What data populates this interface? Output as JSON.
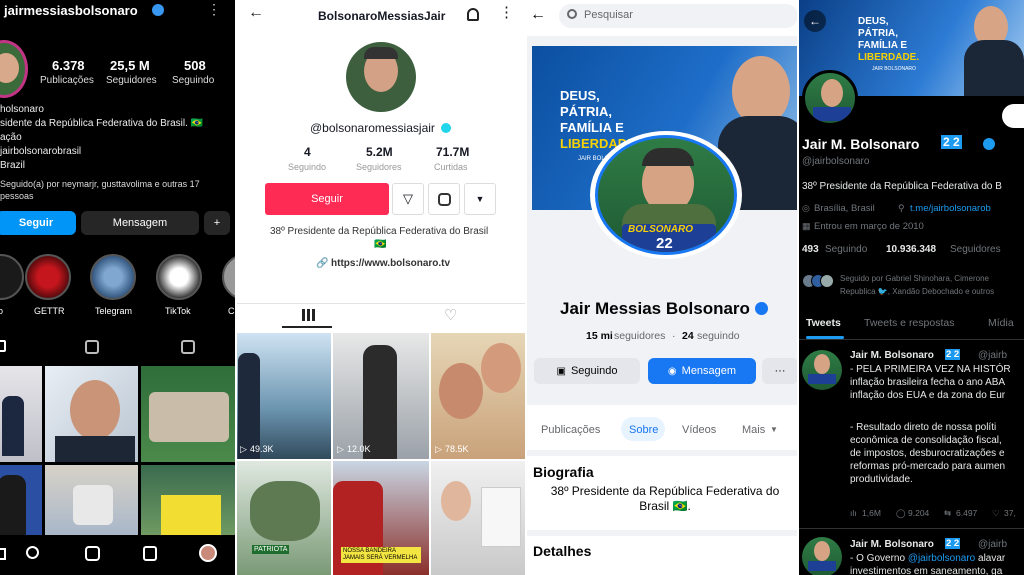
{
  "instagram": {
    "username": "jairmessiasbolsonaro",
    "stats": [
      {
        "value": "6.378",
        "label": "Publicações"
      },
      {
        "value": "25,5 M",
        "label": "Seguidores"
      },
      {
        "value": "508",
        "label": "Seguindo"
      }
    ],
    "bio": [
      "holsonaro",
      "sidente da República Federativa do Brasil. 🇧🇷",
      "ação",
      "jairbolsonarobrasil",
      "Brazil"
    ],
    "followed_by": "Seguido(a) por neymarjr, gusttavolima e outras 17 pessoas",
    "follow_label": "Seguir",
    "message_label": "Mensagem",
    "highlights": [
      "o",
      "GETTR",
      "Telegram",
      "TikTok",
      "Cl"
    ]
  },
  "tiktok": {
    "header_title": "BolsonaroMessiasJair",
    "handle": "@bolsonaromessiasjair",
    "stats": [
      {
        "value": "4",
        "label": "Seguindo"
      },
      {
        "value": "5.2M",
        "label": "Seguidores"
      },
      {
        "value": "71.7M",
        "label": "Curtidas"
      }
    ],
    "follow_label": "Seguir",
    "bio": "38º Presidente da República Federativa do Brasil",
    "flag": "🇧🇷",
    "link": "https://www.bolsonaro.tv",
    "views": [
      "49.3K",
      "12.0K",
      "78.5K",
      "",
      "",
      ""
    ],
    "captions": [
      "",
      "",
      "",
      "PATRIOTA",
      "NOSSA BANDEIRA JAMAIS SERÁ VERMELHA",
      ""
    ],
    "accent": "#fe2c55"
  },
  "facebook": {
    "search_placeholder": "Pesquisar",
    "cover_text": [
      "DEUS,",
      "PÁTRIA,",
      "FAMÍLIA E",
      "LIBERDADE."
    ],
    "cover_small": "JAIR BOLSONARO",
    "badge_text": "BOLSONARO",
    "badge_number": "22",
    "name": "Jair Messias Bolsonaro",
    "followers_count": "15 mi",
    "followers_label": "seguidores",
    "following_count": "24",
    "following_label": "seguindo",
    "following_btn": "Seguindo",
    "message_btn": "Mensagem",
    "more_btn": "···",
    "tabs": [
      "Publicações",
      "Sobre",
      "Vídeos",
      "Mais"
    ],
    "active_tab": "Sobre",
    "bio_title": "Biografia",
    "bio": "38º Presidente da República Federativa do Brasil 🇧🇷.",
    "details_title": "Detalhes",
    "accent": "#1877f2"
  },
  "twitter": {
    "banner_text": [
      "DEUS,",
      "PÁTRIA,",
      "FAMÍLIA E",
      "LIBERDADE."
    ],
    "banner_small": "JAIR BOLSONARO",
    "name": "Jair M. Bolsonaro",
    "name_badge": "2 2",
    "handle": "@jairbolsonaro",
    "bio": "38º Presidente da República Federativa do B",
    "location": "Brasília, Brasil",
    "link": "t.me/jairbolsonarob",
    "joined": "Entrou em março de 2010",
    "following_count": "493",
    "following_label": "Seguindo",
    "followers_count": "10.936.348",
    "followers_label": "Seguidores",
    "followed_by": "Seguido por Gabriel Shinohara, Cimerone",
    "followed_by_2": "Republica 🐦, Xandão Debochado e outros",
    "tabs": [
      "Tweets",
      "Tweets e respostas",
      "Mídia"
    ],
    "tweet1": {
      "name": "Jair M. Bolsonaro",
      "badge": "2 2",
      "handle": "@jairb",
      "lines": [
        "- PELA PRIMEIRA VEZ NA HISTÓR",
        "inflação brasileira fecha o ano ABA",
        "inflação dos EUA e da zona do Eur",
        "",
        "- Resultado direto de nossa políti",
        "econômica de consolidação fiscal,",
        "de impostos, desburocratizações e",
        "reformas pró-mercado para aumen",
        "produtividade."
      ],
      "views": "1,6M",
      "replies": "9.204",
      "retweets": "6.497",
      "likes": "37,"
    },
    "tweet2": {
      "name": "Jair M. Bolsonaro",
      "badge": "2 2",
      "handle": "@jairb",
      "line1_pre": "- O Governo ",
      "line1_mention": "@jairbolsonaro",
      "line1_post": " alavar",
      "line2": "investimentos em saneamento, ga"
    },
    "accent": "#1d9bf0"
  }
}
